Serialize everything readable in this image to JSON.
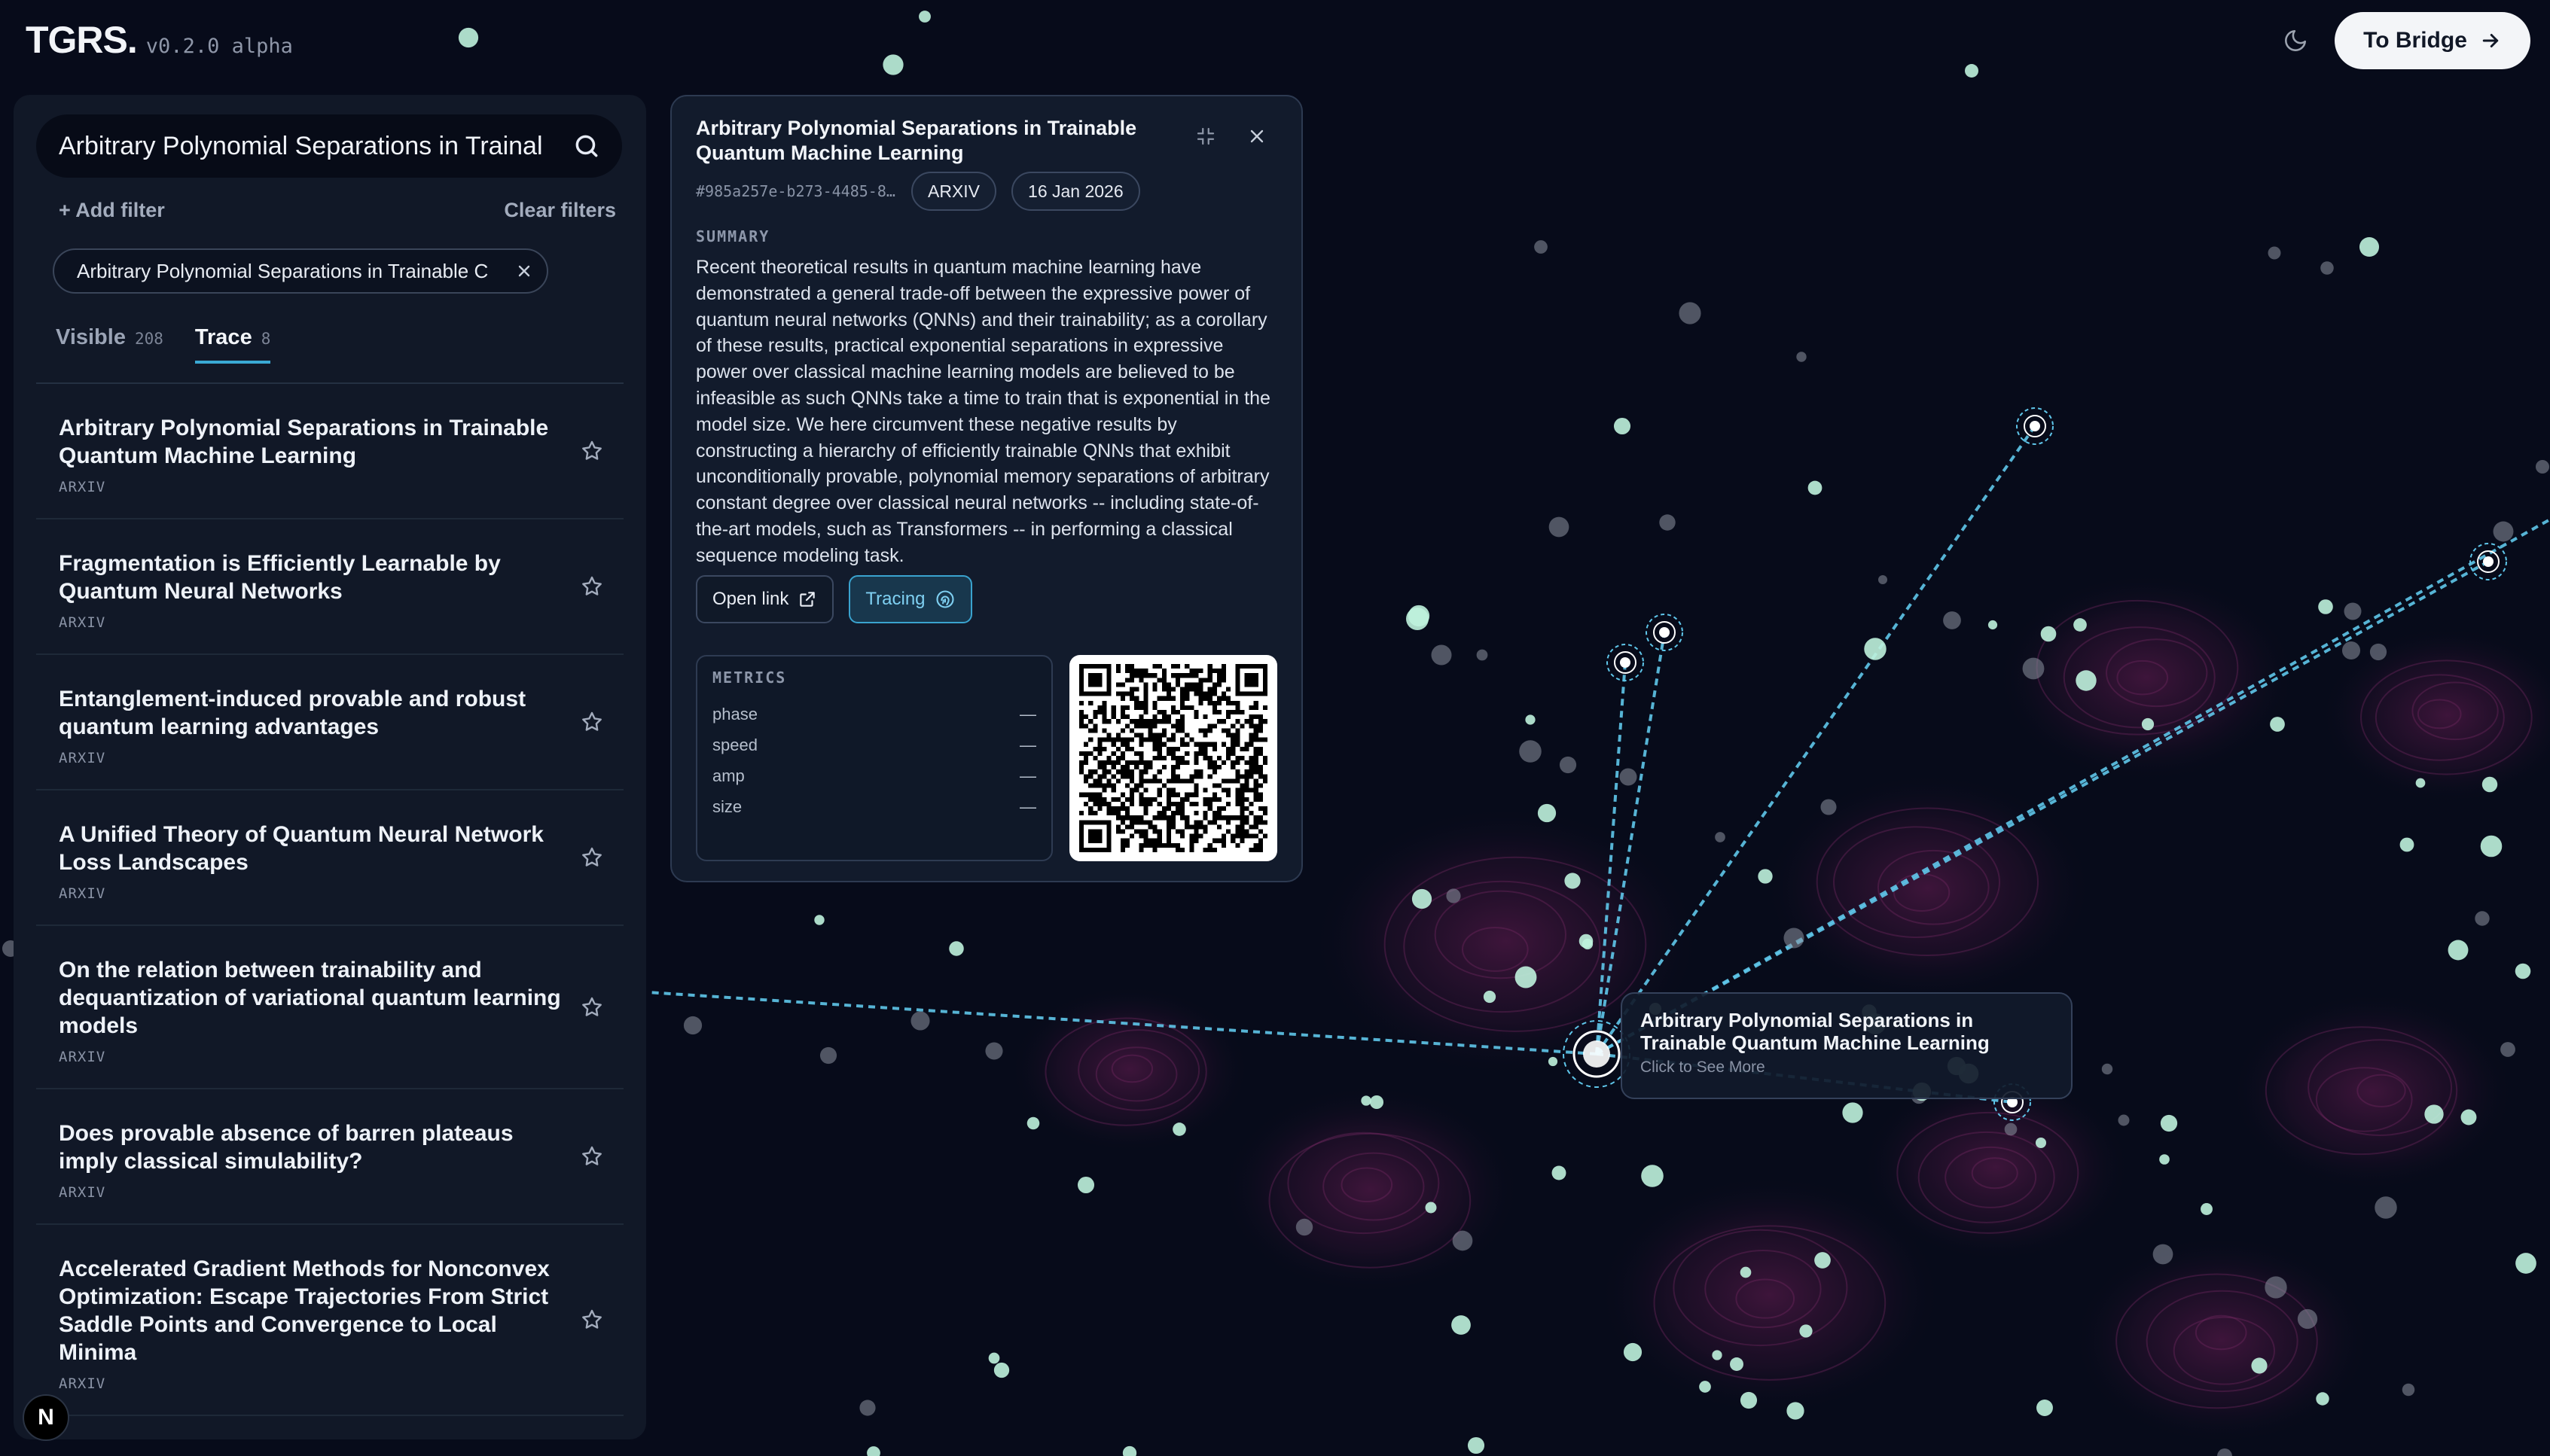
{
  "app": {
    "logo": "TGRS.",
    "version": "v0.2.0 alpha",
    "bridge_button_label": "To Bridge"
  },
  "sidebar": {
    "search_value": "Arbitrary Polynomial Separations in Trainal",
    "add_filter_label": "+ Add filter",
    "clear_filters_label": "Clear filters",
    "active_filter": "Arbitrary Polynomial Separations in Trainable C",
    "tabs": [
      {
        "label": "Visible",
        "count": "208",
        "active": false
      },
      {
        "label": "Trace",
        "count": "8",
        "active": true
      }
    ],
    "papers": [
      {
        "title": "Arbitrary Polynomial Separations in Trainable Quantum Machine Learning",
        "source": "ARXIV"
      },
      {
        "title": "Fragmentation is Efficiently Learnable by Quantum Neural Networks",
        "source": "ARXIV"
      },
      {
        "title": "Entanglement-induced provable and robust quantum learning advantages",
        "source": "ARXIV"
      },
      {
        "title": "A Unified Theory of Quantum Neural Network Loss Landscapes",
        "source": "ARXIV"
      },
      {
        "title": "On the relation between trainability and dequantization of variational quantum learning models",
        "source": "ARXIV"
      },
      {
        "title": "Does provable absence of barren plateaus imply classical simulability?",
        "source": "ARXIV"
      },
      {
        "title": "Accelerated Gradient Methods for Nonconvex Optimization: Escape Trajectories From Strict Saddle Points and Convergence to Local Minima",
        "source": "ARXIV"
      }
    ],
    "footer_badge": "N"
  },
  "detail": {
    "title": "Arbitrary Polynomial Separations in Trainable Quantum Machine Learning",
    "id": "#985a257e-b273-4485-8e...",
    "source": "ARXIV",
    "date": "16 Jan 2026",
    "summary_label": "SUMMARY",
    "summary": "Recent theoretical results in quantum machine learning have demonstrated a general trade-off between the expressive power of quantum neural networks (QNNs) and their trainability; as a corollary of these results, practical exponential separations in expressive power over classical machine learning models are believed to be infeasible as such QNNs take a time to train that is exponential in the model size. We here circumvent these negative results by constructing a hierarchy of efficiently trainable QNNs that exhibit unconditionally provable, polynomial memory separations of arbitrary constant degree over classical neural networks -- including state-of-the-art models, such as Transformers -- in performing a classical sequence modeling task.",
    "open_link_label": "Open link",
    "tracing_label": "Tracing",
    "metrics_label": "METRICS",
    "metrics": [
      {
        "name": "phase",
        "value": "—"
      },
      {
        "name": "speed",
        "value": "—"
      },
      {
        "name": "amp",
        "value": "—"
      },
      {
        "name": "size",
        "value": "—"
      }
    ]
  },
  "graph_tooltip": {
    "title": "Arbitrary Polynomial Separations in Trainable Quantum Machine Learning",
    "subtitle": "Click to See More"
  },
  "colors": {
    "background": "#070b1a",
    "node": "#bff2dd",
    "trace_line": "#5fc6ea",
    "accent": "#3aa9d4",
    "heat": "#6a1d55"
  },
  "icons": [
    "search-icon",
    "close-icon",
    "star-icon",
    "moon-icon",
    "arrow-right-icon",
    "collapse-icon",
    "external-link-icon",
    "fingerprint-icon",
    "qr-code"
  ]
}
